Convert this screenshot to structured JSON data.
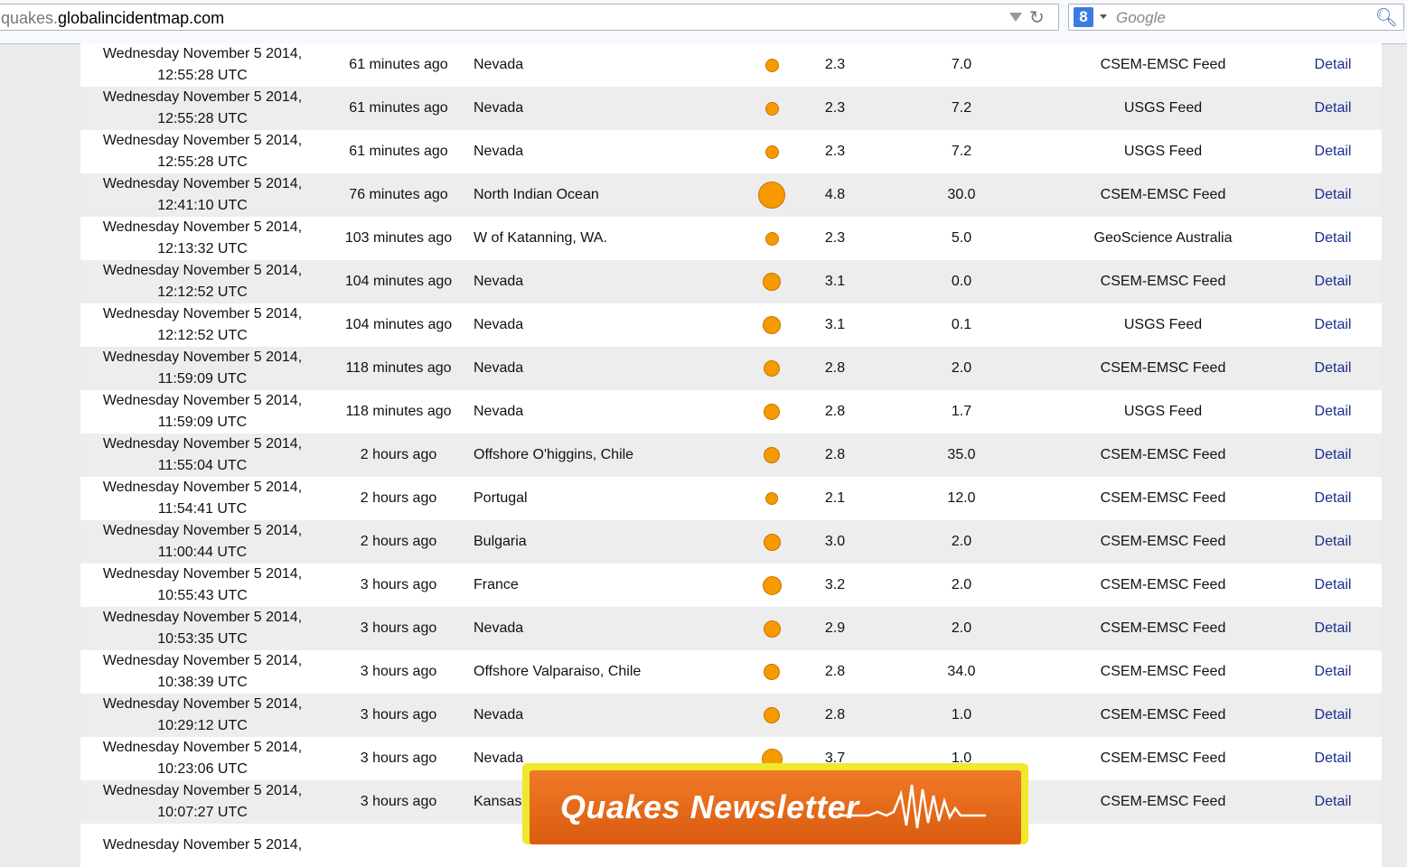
{
  "browser": {
    "url_dim": "quakes.",
    "url_main": "globalincidentmap.com",
    "search_placeholder": "Google"
  },
  "quakes": [
    {
      "date": "Wednesday November 5 2014,",
      "time": "12:55:28 UTC",
      "ago": "61 minutes ago",
      "location": "Nevada",
      "mag": "2.3",
      "depth": "7.0",
      "source": "CSEM-EMSC Feed",
      "detail": "Detail"
    },
    {
      "date": "Wednesday November 5 2014,",
      "time": "12:55:28 UTC",
      "ago": "61 minutes ago",
      "location": "Nevada",
      "mag": "2.3",
      "depth": "7.2",
      "source": "USGS Feed",
      "detail": "Detail"
    },
    {
      "date": "Wednesday November 5 2014,",
      "time": "12:55:28 UTC",
      "ago": "61 minutes ago",
      "location": "Nevada",
      "mag": "2.3",
      "depth": "7.2",
      "source": "USGS Feed",
      "detail": "Detail"
    },
    {
      "date": "Wednesday November 5 2014,",
      "time": "12:41:10 UTC",
      "ago": "76 minutes ago",
      "location": "North Indian Ocean",
      "mag": "4.8",
      "depth": "30.0",
      "source": "CSEM-EMSC Feed",
      "detail": "Detail"
    },
    {
      "date": "Wednesday November 5 2014,",
      "time": "12:13:32 UTC",
      "ago": "103 minutes ago",
      "location": "W of Katanning, WA.",
      "mag": "2.3",
      "depth": "5.0",
      "source": "GeoScience Australia",
      "detail": "Detail"
    },
    {
      "date": "Wednesday November 5 2014,",
      "time": "12:12:52 UTC",
      "ago": "104 minutes ago",
      "location": "Nevada",
      "mag": "3.1",
      "depth": "0.0",
      "source": "CSEM-EMSC Feed",
      "detail": "Detail"
    },
    {
      "date": "Wednesday November 5 2014,",
      "time": "12:12:52 UTC",
      "ago": "104 minutes ago",
      "location": "Nevada",
      "mag": "3.1",
      "depth": "0.1",
      "source": "USGS Feed",
      "detail": "Detail"
    },
    {
      "date": "Wednesday November 5 2014,",
      "time": "11:59:09 UTC",
      "ago": "118 minutes ago",
      "location": "Nevada",
      "mag": "2.8",
      "depth": "2.0",
      "source": "CSEM-EMSC Feed",
      "detail": "Detail"
    },
    {
      "date": "Wednesday November 5 2014,",
      "time": "11:59:09 UTC",
      "ago": "118 minutes ago",
      "location": "Nevada",
      "mag": "2.8",
      "depth": "1.7",
      "source": "USGS Feed",
      "detail": "Detail"
    },
    {
      "date": "Wednesday November 5 2014,",
      "time": "11:55:04 UTC",
      "ago": "2 hours ago",
      "location": "Offshore O'higgins, Chile",
      "mag": "2.8",
      "depth": "35.0",
      "source": "CSEM-EMSC Feed",
      "detail": "Detail"
    },
    {
      "date": "Wednesday November 5 2014,",
      "time": "11:54:41 UTC",
      "ago": "2 hours ago",
      "location": "Portugal",
      "mag": "2.1",
      "depth": "12.0",
      "source": "CSEM-EMSC Feed",
      "detail": "Detail"
    },
    {
      "date": "Wednesday November 5 2014,",
      "time": "11:00:44 UTC",
      "ago": "2 hours ago",
      "location": "Bulgaria",
      "mag": "3.0",
      "depth": "2.0",
      "source": "CSEM-EMSC Feed",
      "detail": "Detail"
    },
    {
      "date": "Wednesday November 5 2014,",
      "time": "10:55:43 UTC",
      "ago": "3 hours ago",
      "location": "France",
      "mag": "3.2",
      "depth": "2.0",
      "source": "CSEM-EMSC Feed",
      "detail": "Detail"
    },
    {
      "date": "Wednesday November 5 2014,",
      "time": "10:53:35 UTC",
      "ago": "3 hours ago",
      "location": "Nevada",
      "mag": "2.9",
      "depth": "2.0",
      "source": "CSEM-EMSC Feed",
      "detail": "Detail"
    },
    {
      "date": "Wednesday November 5 2014,",
      "time": "10:38:39 UTC",
      "ago": "3 hours ago",
      "location": "Offshore Valparaiso, Chile",
      "mag": "2.8",
      "depth": "34.0",
      "source": "CSEM-EMSC Feed",
      "detail": "Detail"
    },
    {
      "date": "Wednesday November 5 2014,",
      "time": "10:29:12 UTC",
      "ago": "3 hours ago",
      "location": "Nevada",
      "mag": "2.8",
      "depth": "1.0",
      "source": "CSEM-EMSC Feed",
      "detail": "Detail"
    },
    {
      "date": "Wednesday November 5 2014,",
      "time": "10:23:06 UTC",
      "ago": "3 hours ago",
      "location": "Nevada",
      "mag": "3.7",
      "depth": "1.0",
      "source": "CSEM-EMSC Feed",
      "detail": "Detail"
    },
    {
      "date": "Wednesday November 5 2014,",
      "time": "10:07:27 UTC",
      "ago": "3 hours ago",
      "location": "Kansas",
      "mag": "",
      "depth": "",
      "source": "CSEM-EMSC Feed",
      "detail": "Detail"
    },
    {
      "date": "Wednesday November 5 2014,",
      "time": "",
      "ago": "",
      "location": "",
      "mag": "",
      "depth": "",
      "source": "",
      "detail": ""
    }
  ],
  "newsletter": {
    "label": "Quakes Newsletter"
  },
  "colors": {
    "dot": "#f79a00",
    "link": "#1a2d8f"
  }
}
